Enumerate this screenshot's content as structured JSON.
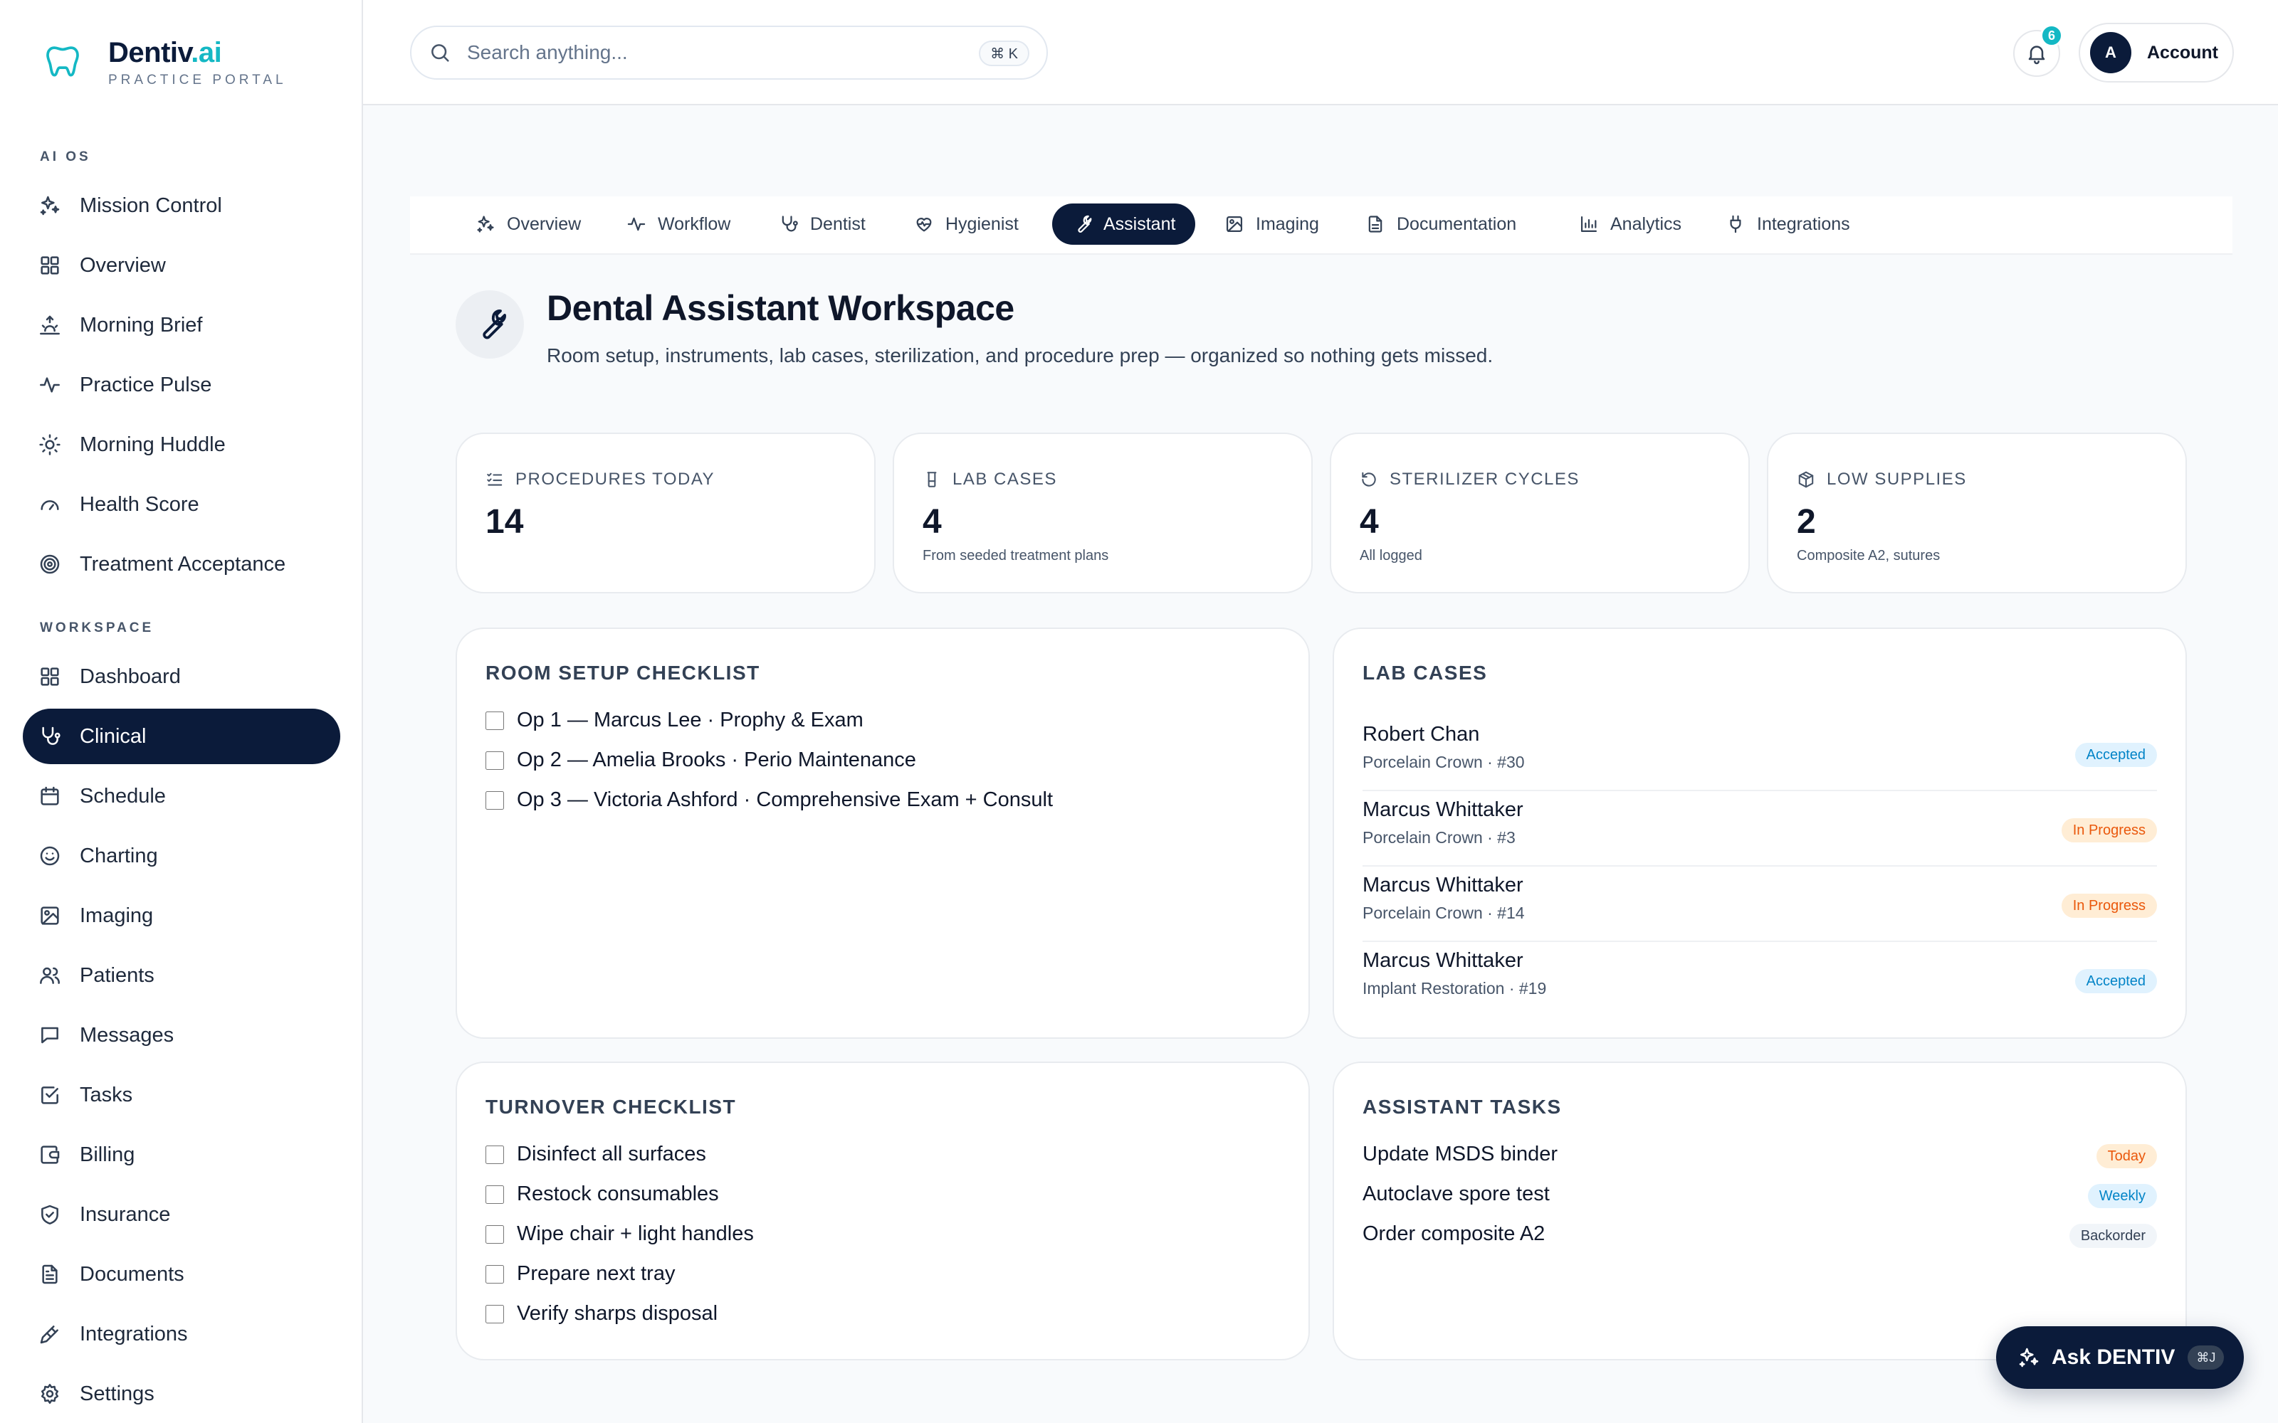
{
  "brand": {
    "name": "Dentiv",
    "suffix": ".ai",
    "subtitle": "PRACTICE PORTAL"
  },
  "sidebar": {
    "sections": [
      {
        "label": "AI OS",
        "items": [
          {
            "label": "Mission Control",
            "icon": "sparkles-icon"
          },
          {
            "label": "Overview",
            "icon": "grid-icon"
          },
          {
            "label": "Morning Brief",
            "icon": "sunrise-icon"
          },
          {
            "label": "Practice Pulse",
            "icon": "activity-icon"
          },
          {
            "label": "Morning Huddle",
            "icon": "sun-icon"
          },
          {
            "label": "Health Score",
            "icon": "gauge-icon"
          },
          {
            "label": "Treatment Acceptance",
            "icon": "target-icon"
          }
        ]
      },
      {
        "label": "WORKSPACE",
        "items": [
          {
            "label": "Dashboard",
            "icon": "grid-icon"
          },
          {
            "label": "Clinical",
            "icon": "stethoscope-icon",
            "active": true
          },
          {
            "label": "Schedule",
            "icon": "calendar-icon"
          },
          {
            "label": "Charting",
            "icon": "smile-icon"
          },
          {
            "label": "Imaging",
            "icon": "image-icon"
          },
          {
            "label": "Patients",
            "icon": "users-icon"
          },
          {
            "label": "Messages",
            "icon": "message-icon"
          },
          {
            "label": "Tasks",
            "icon": "check-square-icon"
          },
          {
            "label": "Billing",
            "icon": "wallet-icon"
          },
          {
            "label": "Insurance",
            "icon": "shield-icon"
          },
          {
            "label": "Documents",
            "icon": "document-icon"
          },
          {
            "label": "Integrations",
            "icon": "plug-icon"
          },
          {
            "label": "Settings",
            "icon": "gear-icon"
          }
        ]
      }
    ]
  },
  "topbar": {
    "search_placeholder": "Search anything...",
    "search_shortcut": "⌘ K",
    "notifications_count": "6",
    "account_initial": "A",
    "account_label": "Account"
  },
  "tabs": [
    {
      "label": "Overview",
      "icon": "sparkles-icon"
    },
    {
      "label": "Workflow",
      "icon": "activity-icon"
    },
    {
      "label": "Dentist",
      "icon": "stethoscope-icon"
    },
    {
      "label": "Hygienist",
      "icon": "heart-pulse-icon"
    },
    {
      "label": "Assistant",
      "icon": "wrench-icon",
      "active": true
    },
    {
      "label": "Imaging",
      "icon": "image-icon"
    },
    {
      "label": "Documentation",
      "icon": "document-icon"
    },
    {
      "label": "Analytics",
      "icon": "bar-chart-icon"
    },
    {
      "label": "Integrations",
      "icon": "plug-icon"
    }
  ],
  "page": {
    "title": "Dental Assistant Workspace",
    "subtitle": "Room setup, instruments, lab cases, sterilization, and procedure prep — organized so nothing gets missed."
  },
  "stats": [
    {
      "label": "PROCEDURES TODAY",
      "value": "14",
      "note": "",
      "icon": "list-check-icon"
    },
    {
      "label": "LAB CASES",
      "value": "4",
      "note": "From seeded treatment plans",
      "icon": "flask-icon"
    },
    {
      "label": "STERILIZER CYCLES",
      "value": "4",
      "note": "All logged",
      "icon": "refresh-icon"
    },
    {
      "label": "LOW SUPPLIES",
      "value": "2",
      "note": "Composite A2, sutures",
      "icon": "package-icon"
    }
  ],
  "room_setup": {
    "title": "ROOM SETUP CHECKLIST",
    "items": [
      "Op 1 — Marcus Lee · Prophy & Exam",
      "Op 2 — Amelia Brooks · Perio Maintenance",
      "Op 3 — Victoria Ashford · Comprehensive Exam + Consult"
    ]
  },
  "lab_cases": {
    "title": "LAB CASES",
    "rows": [
      {
        "name": "Robert Chan",
        "detail": "Porcelain Crown · #30",
        "status": "Accepted",
        "tone": "blue"
      },
      {
        "name": "Marcus Whittaker",
        "detail": "Porcelain Crown · #3",
        "status": "In Progress",
        "tone": "orange"
      },
      {
        "name": "Marcus Whittaker",
        "detail": "Porcelain Crown · #14",
        "status": "In Progress",
        "tone": "orange"
      },
      {
        "name": "Marcus Whittaker",
        "detail": "Implant Restoration · #19",
        "status": "Accepted",
        "tone": "blue"
      }
    ]
  },
  "turnover": {
    "title": "TURNOVER CHECKLIST",
    "items": [
      "Disinfect all surfaces",
      "Restock consumables",
      "Wipe chair + light handles",
      "Prepare next tray",
      "Verify sharps disposal"
    ]
  },
  "assistant_tasks": {
    "title": "ASSISTANT TASKS",
    "rows": [
      {
        "label": "Update MSDS binder",
        "tag": "Today",
        "tone": "orange"
      },
      {
        "label": "Autoclave spore test",
        "tag": "Weekly",
        "tone": "blue"
      },
      {
        "label": "Order composite A2",
        "tag": "Backorder",
        "tone": "gray"
      }
    ]
  },
  "ask": {
    "label": "Ask DENTIV",
    "shortcut": "⌘J"
  }
}
